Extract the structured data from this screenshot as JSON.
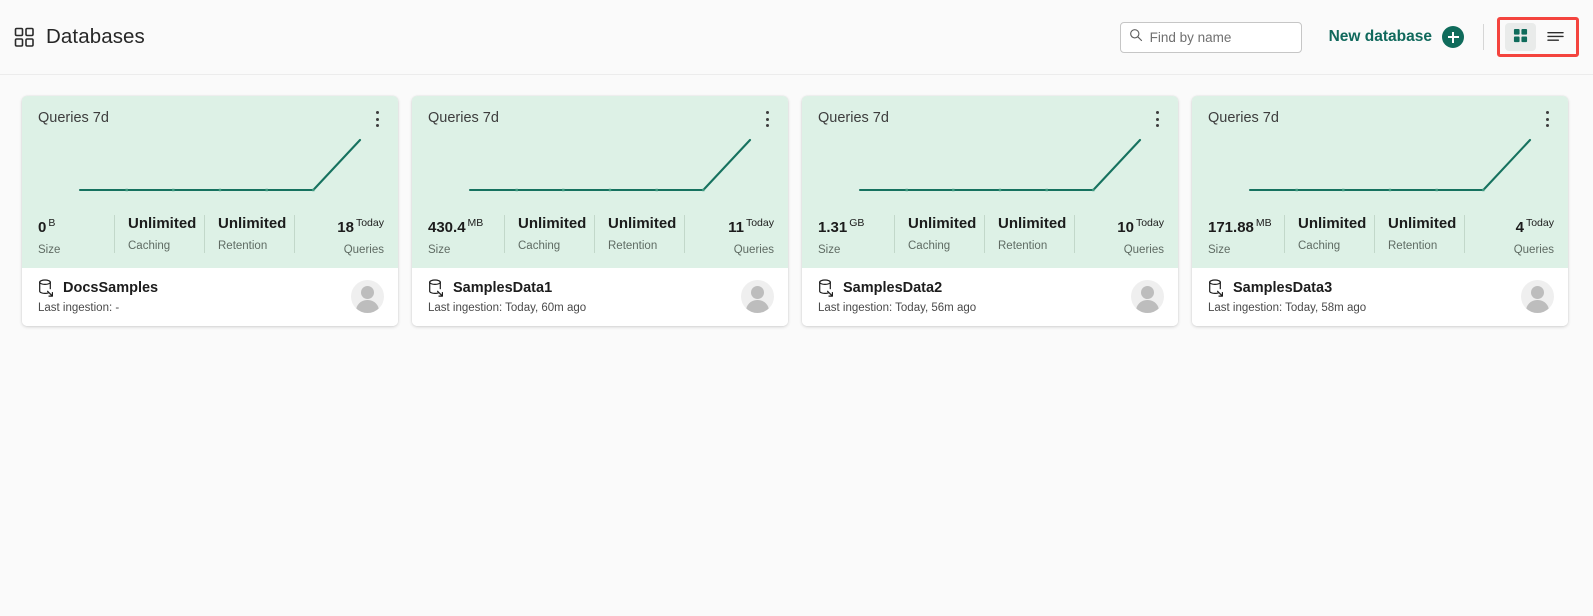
{
  "header": {
    "title": "Databases",
    "grid_icon": "grid-icon",
    "search": {
      "placeholder": "Find by name",
      "value": "",
      "icon": "search-icon"
    },
    "new_database": {
      "label": "New database",
      "icon": "plus-icon"
    },
    "view_toggle": {
      "grid": {
        "name": "grid-view",
        "active": true,
        "icon": "grid-view-icon"
      },
      "list": {
        "name": "list-view",
        "active": false,
        "icon": "list-view-icon"
      }
    }
  },
  "colors": {
    "accent": "#0f6b5b",
    "card_top_bg": "#ddf1e6",
    "chart_line": "#16725f",
    "highlight_box": "#f4443e",
    "page_bg": "#fafafa"
  },
  "stat_labels": {
    "size": "Size",
    "caching": "Caching",
    "retention": "Retention",
    "queries": "Queries"
  },
  "chart_data": [
    {
      "type": "line",
      "title": "Queries 7d",
      "x": [
        1,
        2,
        3,
        4,
        5,
        6,
        7
      ],
      "values": [
        0,
        0,
        0,
        0,
        0,
        0,
        18
      ],
      "xlabel": "",
      "ylabel": "",
      "ylim": [
        0,
        18
      ],
      "grid": false,
      "legend": "none"
    },
    {
      "type": "line",
      "title": "Queries 7d",
      "x": [
        1,
        2,
        3,
        4,
        5,
        6,
        7
      ],
      "values": [
        0,
        0,
        0,
        0,
        0,
        0,
        11
      ],
      "xlabel": "",
      "ylabel": "",
      "ylim": [
        0,
        11
      ],
      "grid": false,
      "legend": "none"
    },
    {
      "type": "line",
      "title": "Queries 7d",
      "x": [
        1,
        2,
        3,
        4,
        5,
        6,
        7
      ],
      "values": [
        0,
        0,
        0,
        0,
        0,
        0,
        10
      ],
      "xlabel": "",
      "ylabel": "",
      "ylim": [
        0,
        10
      ],
      "grid": false,
      "legend": "none"
    },
    {
      "type": "line",
      "title": "Queries 7d",
      "x": [
        1,
        2,
        3,
        4,
        5,
        6,
        7
      ],
      "values": [
        0,
        0,
        0,
        0,
        0,
        0,
        4
      ],
      "xlabel": "",
      "ylabel": "",
      "ylim": [
        0,
        4
      ],
      "grid": false,
      "legend": "none"
    }
  ],
  "cards": [
    {
      "chart_title": "Queries 7d",
      "size_value": "0",
      "size_unit": "B",
      "caching_value": "Unlimited",
      "retention_value": "Unlimited",
      "queries_value": "18",
      "queries_unit": "Today",
      "db_name": "DocsSamples",
      "last_ingestion": "Last ingestion: -"
    },
    {
      "chart_title": "Queries 7d",
      "size_value": "430.4",
      "size_unit": "MB",
      "caching_value": "Unlimited",
      "retention_value": "Unlimited",
      "queries_value": "11",
      "queries_unit": "Today",
      "db_name": "SamplesData1",
      "last_ingestion": "Last ingestion: Today, 60m ago"
    },
    {
      "chart_title": "Queries 7d",
      "size_value": "1.31",
      "size_unit": "GB",
      "caching_value": "Unlimited",
      "retention_value": "Unlimited",
      "queries_value": "10",
      "queries_unit": "Today",
      "db_name": "SamplesData2",
      "last_ingestion": "Last ingestion: Today, 56m ago"
    },
    {
      "chart_title": "Queries 7d",
      "size_value": "171.88",
      "size_unit": "MB",
      "caching_value": "Unlimited",
      "retention_value": "Unlimited",
      "queries_value": "4",
      "queries_unit": "Today",
      "db_name": "SamplesData3",
      "last_ingestion": "Last ingestion: Today, 58m ago"
    }
  ]
}
